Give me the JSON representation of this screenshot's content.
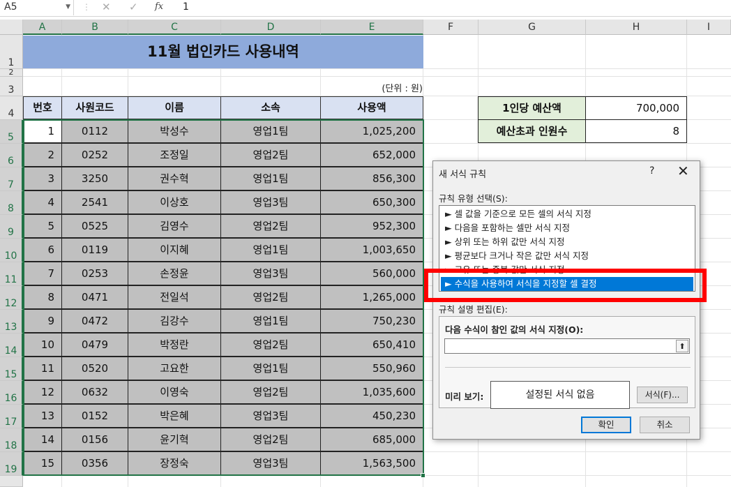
{
  "formula_bar": {
    "name_box": "A5",
    "cancel_icon": "✕",
    "enter_icon": "✓",
    "fx_icon": "fx",
    "formula": "1"
  },
  "columns": [
    "A",
    "B",
    "C",
    "D",
    "E",
    "F",
    "G",
    "H",
    "I"
  ],
  "rows": [
    "1",
    "2",
    "3",
    "4",
    "5",
    "6",
    "7",
    "8",
    "9",
    "10",
    "11",
    "12",
    "13",
    "14",
    "15",
    "16",
    "17",
    "18",
    "19"
  ],
  "sheet": {
    "title": "11월 법인카드 사용내역",
    "unit": "(단위 : 원)",
    "headers": [
      "번호",
      "사원코드",
      "이름",
      "소속",
      "사용액"
    ],
    "data": [
      [
        "1",
        "0112",
        "박성수",
        "영업1팀",
        "1,025,200"
      ],
      [
        "2",
        "0252",
        "조정일",
        "영업2팀",
        "652,000"
      ],
      [
        "3",
        "3250",
        "권수혁",
        "영업1팀",
        "856,300"
      ],
      [
        "4",
        "2541",
        "이상호",
        "영업3팀",
        "650,300"
      ],
      [
        "5",
        "0525",
        "김영수",
        "영업2팀",
        "952,300"
      ],
      [
        "6",
        "0119",
        "이지혜",
        "영업1팀",
        "1,003,650"
      ],
      [
        "7",
        "0253",
        "손정윤",
        "영업3팀",
        "560,000"
      ],
      [
        "8",
        "0471",
        "전일석",
        "영업2팀",
        "1,265,000"
      ],
      [
        "9",
        "0472",
        "김강수",
        "영업1팀",
        "750,230"
      ],
      [
        "10",
        "0479",
        "박정란",
        "영업2팀",
        "650,410"
      ],
      [
        "11",
        "0520",
        "고요한",
        "영업1팀",
        "550,960"
      ],
      [
        "12",
        "0632",
        "이영숙",
        "영업2팀",
        "1,035,600"
      ],
      [
        "13",
        "0152",
        "박은혜",
        "영업3팀",
        "450,230"
      ],
      [
        "14",
        "0156",
        "윤기혁",
        "영업2팀",
        "685,000"
      ],
      [
        "15",
        "0356",
        "장정숙",
        "영업3팀",
        "1,563,500"
      ]
    ],
    "budget": [
      {
        "label": "1인당 예산액",
        "value": "700,000"
      },
      {
        "label": "예산초과 인원수",
        "value": "8"
      }
    ]
  },
  "dialog": {
    "title": "새 서식 규칙",
    "help": "?",
    "close": "✕",
    "rule_type_label": "규칙 유형 선택(S):",
    "rule_types": [
      "► 셀 값을 기준으로 모든 셀의 서식 지정",
      "► 다음을 포함하는 셀만 서식 지정",
      "► 상위 또는 하위 값만 서식 지정",
      "► 평균보다 크거나 작은 값만 서식 지정",
      "► 고유 또는 중복 값만 서식 지정",
      "► 수식을 사용하여 서식을 지정할 셀 결정"
    ],
    "selected_rule_index": 5,
    "edit_label": "규칙 설명 편집(E):",
    "formula_label": "다음 수식이 참인 값의 서식 지정(O):",
    "formula_value": "",
    "collapse_icon": "⬆",
    "preview_label": "미리 보기:",
    "preview_text": "설정된 서식 없음",
    "format_button": "서식(F)...",
    "ok_button": "확인",
    "cancel_button": "취소"
  },
  "colors": {
    "title_fill": "#8eaadb",
    "header_fill": "#d9e1f2",
    "data_fill": "#c0c0c0",
    "budget_label_fill": "#e2efda",
    "selection": "#217346",
    "highlight": "#ff0000",
    "list_selection": "#0078d7"
  }
}
